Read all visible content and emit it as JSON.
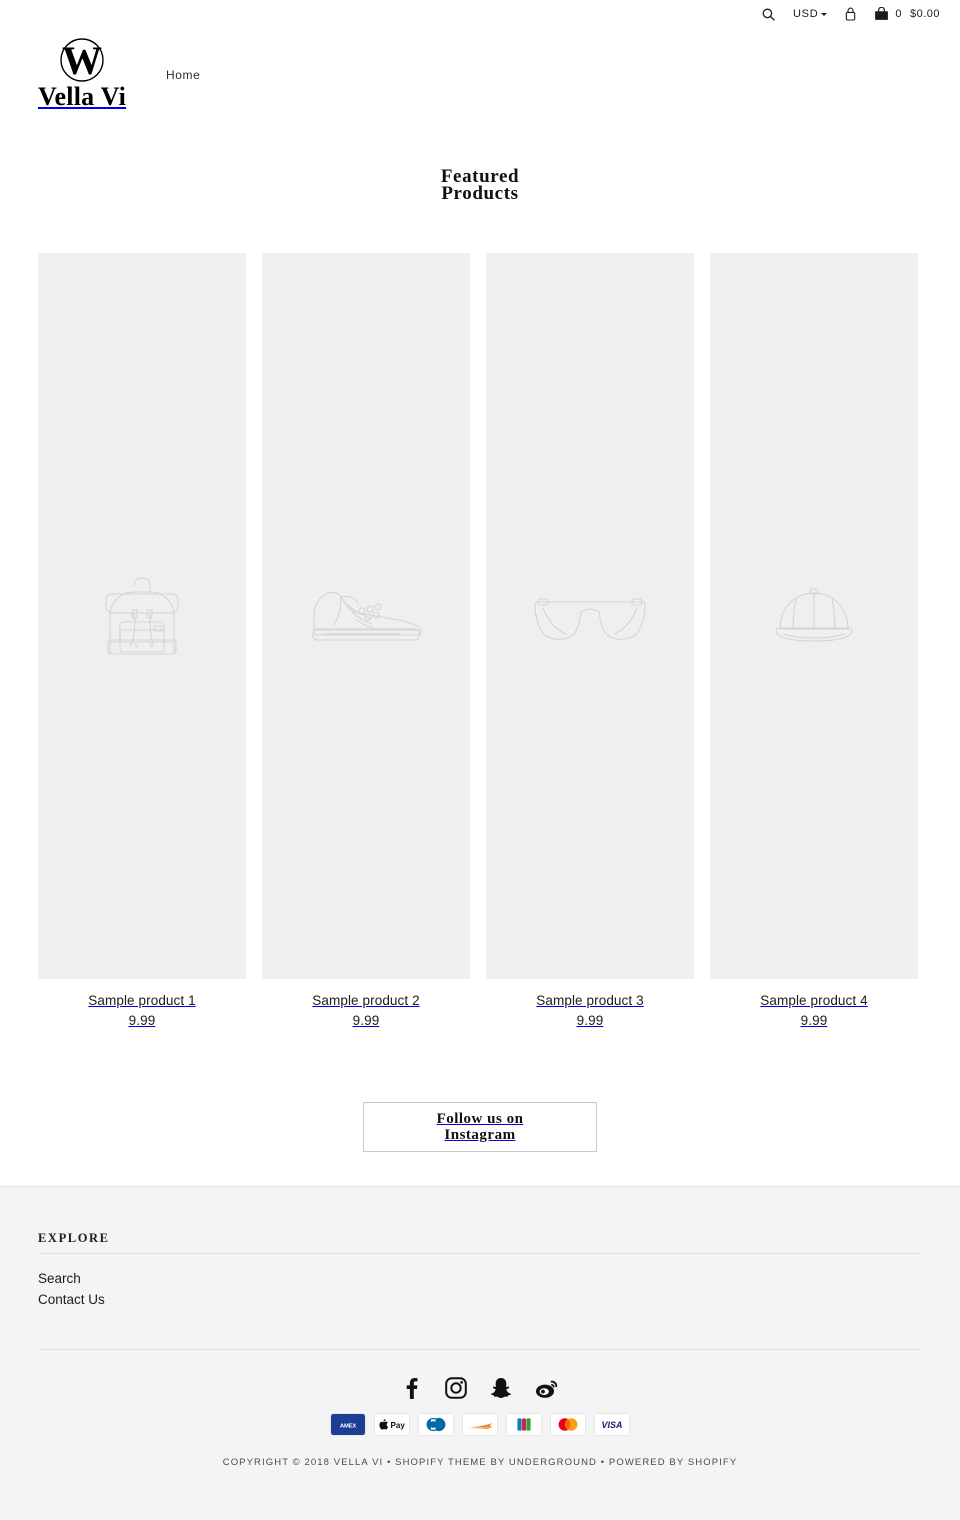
{
  "utility_bar": {
    "search_icon": "search-icon",
    "currency": "USD",
    "currency_caret": "chevron-down-icon",
    "account_icon": "account-lock-icon",
    "cart_icon": "cart-bag-icon",
    "cart_count": "0",
    "cart_total": "$0.00"
  },
  "header": {
    "logo_mark": "w-in-circle-logo",
    "logo_text": "Vella Vi",
    "nav": [
      {
        "label": "Home"
      }
    ]
  },
  "featured": {
    "title_line1": "Featured",
    "title_line2": "Products",
    "products": [
      {
        "title": "Sample product 1",
        "price": "9.99",
        "placeholder": "backpack-icon"
      },
      {
        "title": "Sample product 2",
        "price": "9.99",
        "placeholder": "sneaker-icon"
      },
      {
        "title": "Sample product 3",
        "price": "9.99",
        "placeholder": "eyeglasses-icon"
      },
      {
        "title": "Sample product 4",
        "price": "9.99",
        "placeholder": "baseball-cap-icon"
      }
    ]
  },
  "instagram_cta": {
    "line1": "Follow us on",
    "line2": "Instagram"
  },
  "footer": {
    "column_heading": "EXPLORE",
    "links": [
      {
        "label": "Search"
      },
      {
        "label": "Contact Us"
      }
    ],
    "social": [
      {
        "name": "facebook-icon"
      },
      {
        "name": "instagram-icon"
      },
      {
        "name": "snapchat-icon"
      },
      {
        "name": "weibo-icon"
      }
    ],
    "payments": [
      {
        "name": "amex-icon",
        "label": "AMEX"
      },
      {
        "name": "apple-pay-icon",
        "label": "Pay"
      },
      {
        "name": "diners-club-icon",
        "label": "Diners"
      },
      {
        "name": "discover-icon",
        "label": "Discover"
      },
      {
        "name": "jcb-icon",
        "label": "JCB"
      },
      {
        "name": "mastercard-icon",
        "label": "Mastercard"
      },
      {
        "name": "visa-icon",
        "label": "VISA"
      }
    ],
    "copyright": "COPYRIGHT © 2018 VELLA VI • SHOPIFY THEME BY UNDERGROUND •  POWERED BY SHOPIFY"
  },
  "colors": {
    "page_background": "#ffffff",
    "product_tile": "#efefef",
    "footer_background": "#f4f4f4",
    "text": "#1c1c1c",
    "placeholder_line": "#d4d4d4"
  }
}
